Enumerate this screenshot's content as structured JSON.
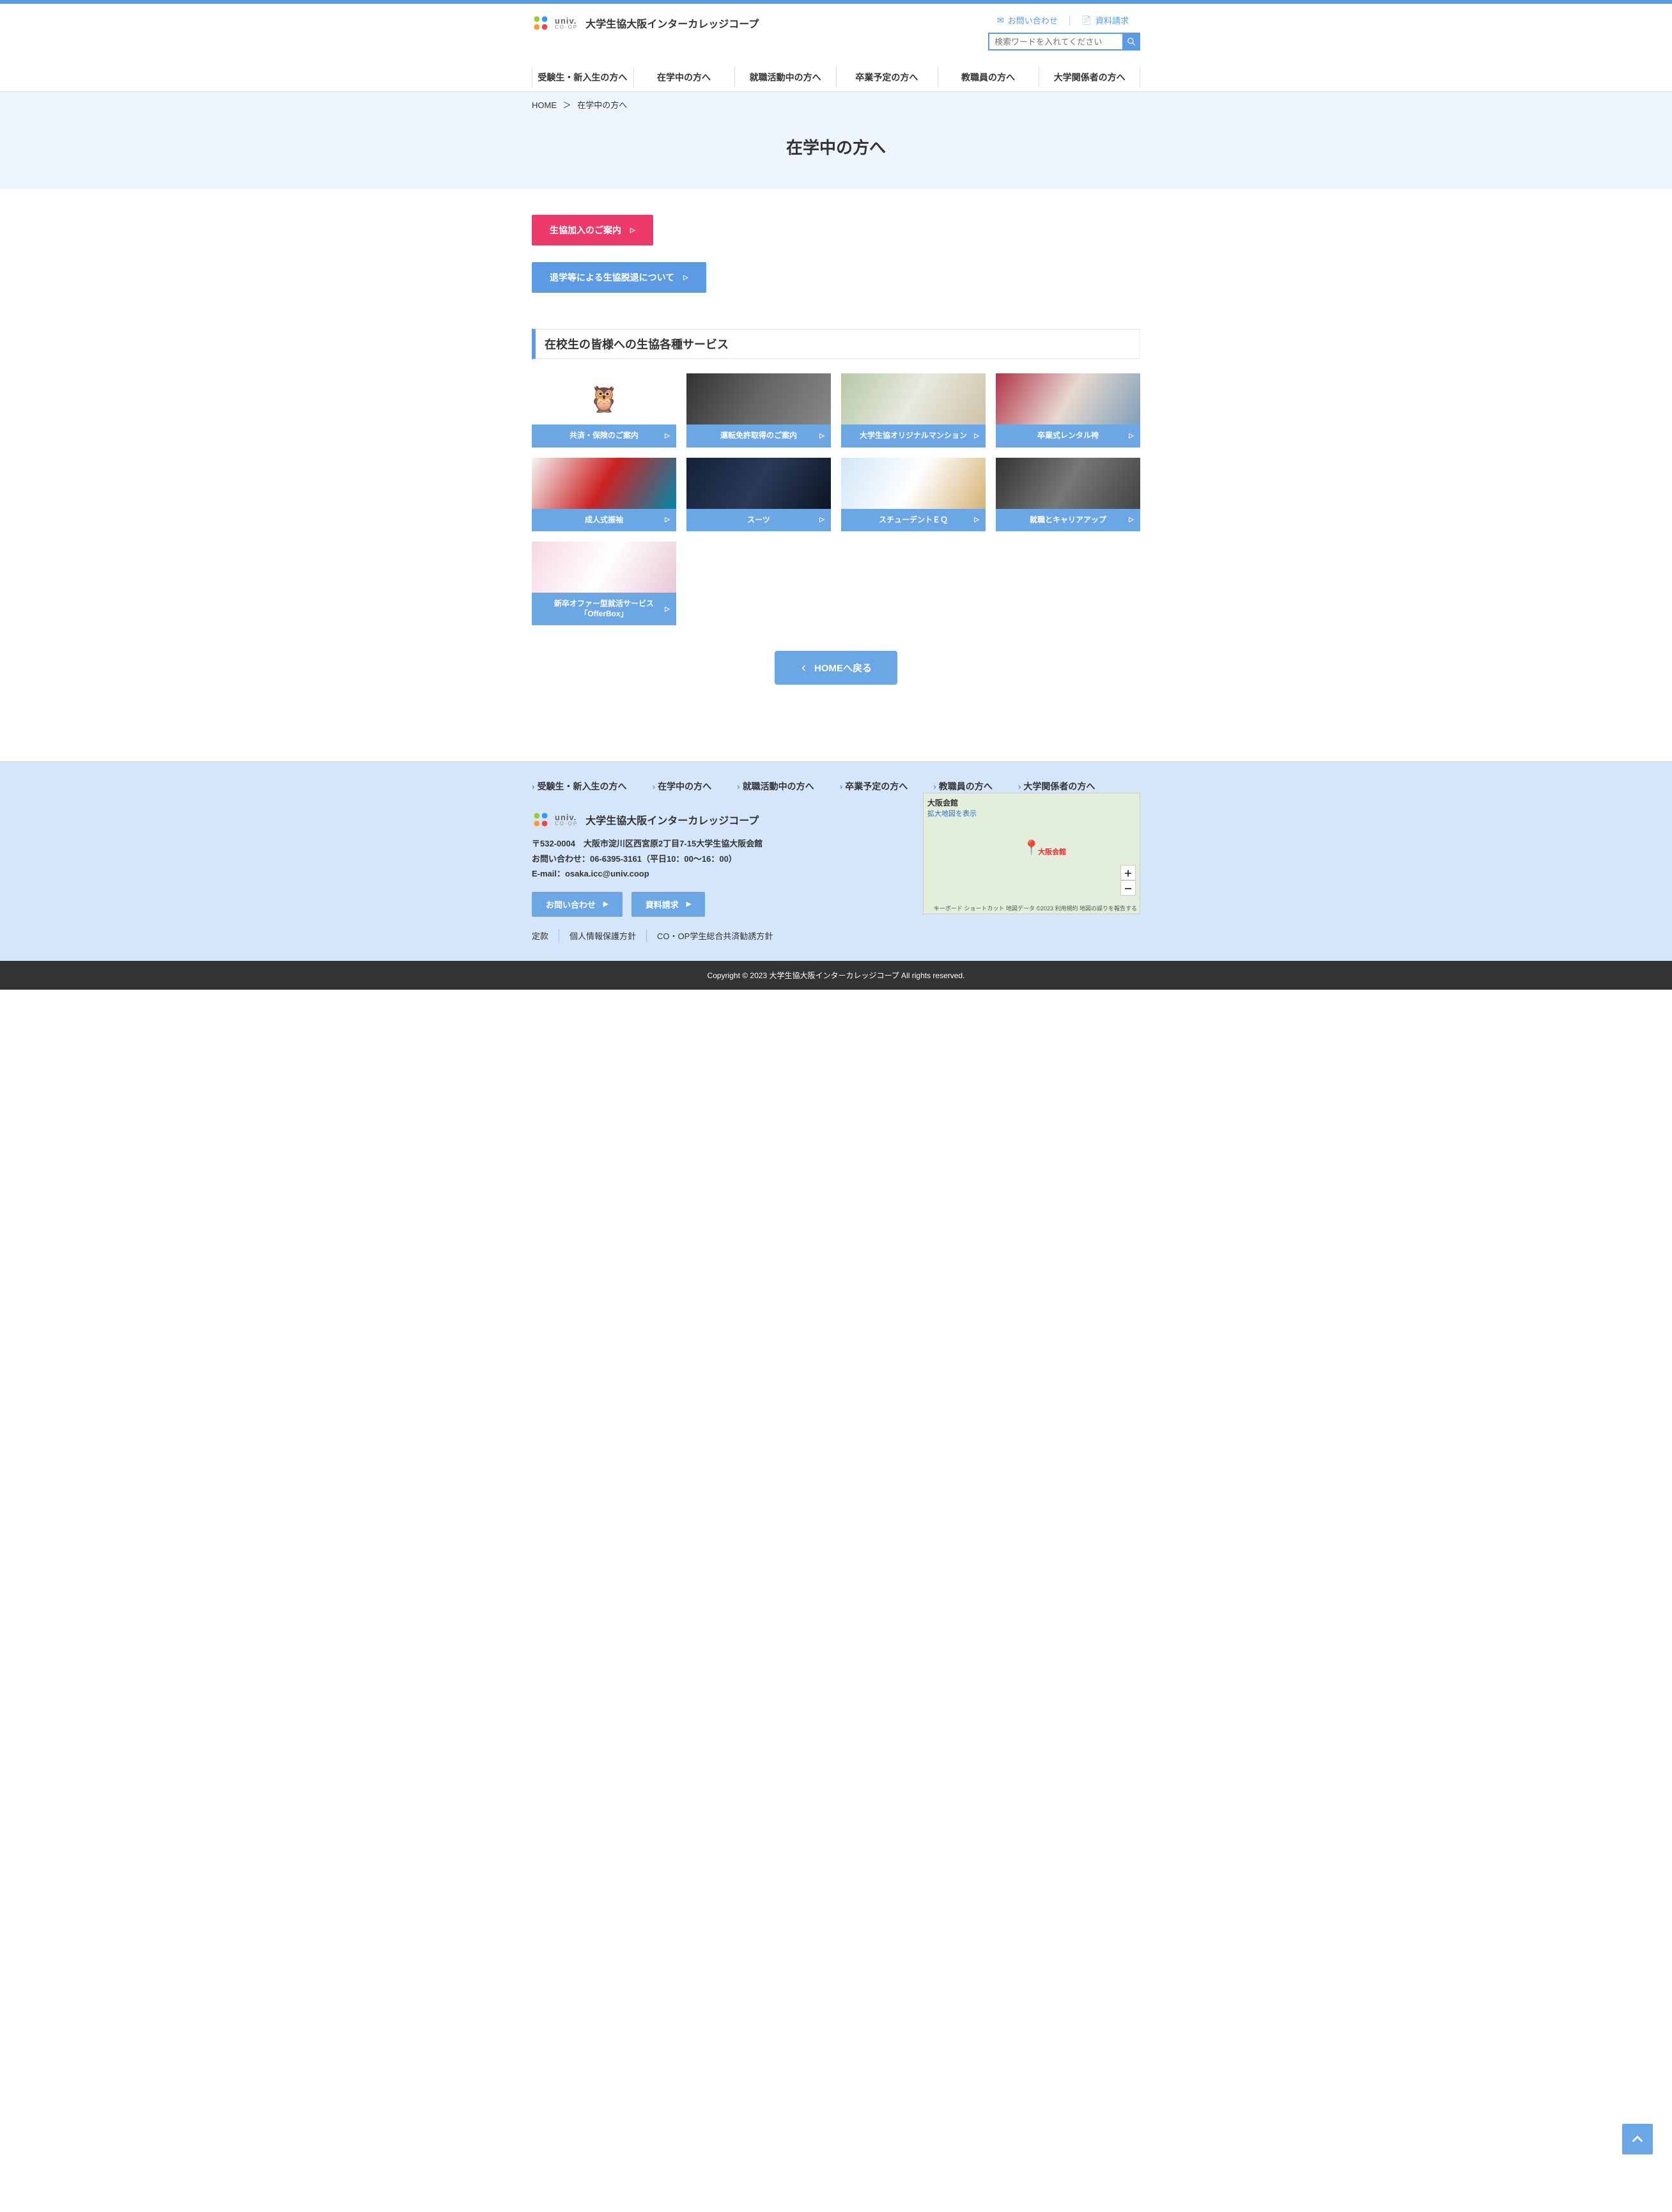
{
  "brand": {
    "univ_mark": "univ.",
    "coop_sub": "CO-OP",
    "name": "大学生協大阪インターカレッジコープ"
  },
  "util": {
    "contact": "お問い合わせ",
    "docs": "資料請求"
  },
  "search": {
    "placeholder": "検索ワードを入れてください"
  },
  "gnav": [
    "受験生・新入生の方へ",
    "在学中の方へ",
    "就職活動中の方へ",
    "卒業予定の方へ",
    "教職員の方へ",
    "大学関係者の方へ"
  ],
  "breadcrumb": {
    "home": "HOME",
    "current": "在学中の方へ"
  },
  "page_title": "在学中の方へ",
  "cta_join": "生協加入のご案内",
  "cta_withdraw": "退学等による生協脱退について",
  "section_title": "在校生の皆様への生協各種サービス",
  "cards": [
    "共済・保険のご案内",
    "運転免許取得のご案内",
    "大学生協オリジナルマンション",
    "卒業式レンタル袴",
    "成人式振袖",
    "スーツ",
    "スチューデントＥＱ",
    "就職とキャリアアップ",
    "新卒オファー型就活サービス「OfferBox」"
  ],
  "back_home": "HOMEへ戻る",
  "footer": {
    "org": "大学生協大阪インターカレッジコープ",
    "postal": "〒532-0004　大阪市淀川区西宮原2丁目7-15大学生協大阪会館",
    "tel": "お問い合わせ：06-6395-3161（平日10：00～16：00）",
    "email": "E-mail：osaka.icc@univ.coop",
    "contact_btn": "お問い合わせ",
    "docs_btn": "資料請求",
    "links": [
      "定款",
      "個人情報保護方針",
      "CO・OP学生総合共済勧誘方針"
    ]
  },
  "map": {
    "title": "大阪会館",
    "enlarge": "拡大地図を表示",
    "attr": "キーボード ショートカット  地図データ ©2023  利用規約  地図の誤りを報告する"
  },
  "copyright": "Copyright © 2023 大学生協大阪インターカレッジコープ All rights reserved."
}
